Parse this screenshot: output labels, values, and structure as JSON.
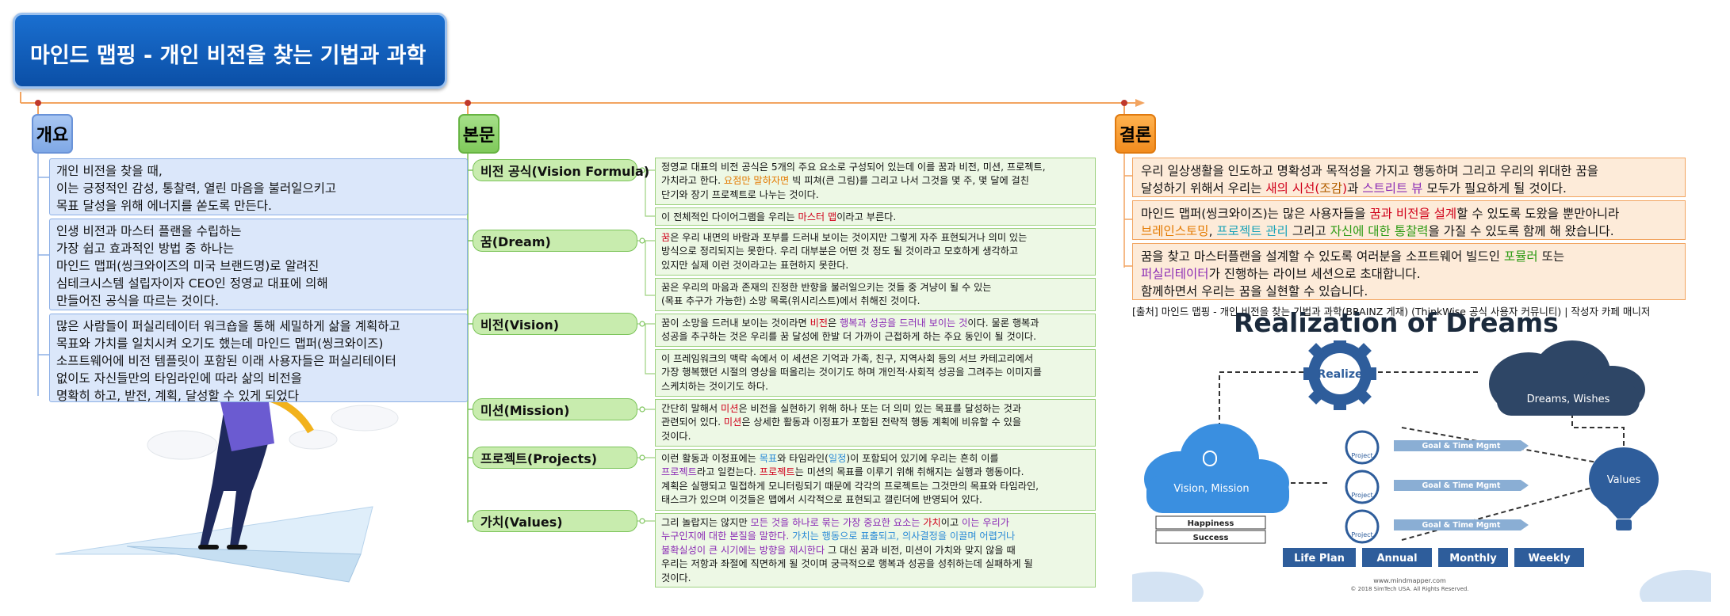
{
  "title": "마인드 맵핑 - 개인 비전을 찾는 기법과 과학",
  "sections": {
    "overview": "개요",
    "main": "본문",
    "conclusion": "결론"
  },
  "overview": {
    "box1": [
      "개인 비전을 찾을 때,",
      "이는 긍정적인 감성, 통찰력, 열린 마음을 불러일으키고",
      "목표 달성을 위해 에너지를 쏟도록 만든다."
    ],
    "box2": [
      "인생 비전과 마스터 플랜을 수립하는",
      "가장 쉽고 효과적인 방법 중 하나는",
      "마인드 맵퍼(씽크와이즈의 미국 브랜드명)로 알려진",
      "심테크시스템 설립자이자 CEO인 정영교 대표에 의해",
      "만들어진 공식을 따르는 것이다."
    ],
    "box3": [
      "많은 사람들이 퍼실리테이터 워크숍을 통해 세밀하게 삶을 계획하고",
      "목표와 가치를 일치시켜 오기도 했는데 마인드 맵퍼(씽크와이즈)",
      "소프트웨어에 비전 템플릿이 포함된 이래 사용자들은 퍼실리테이터",
      "없이도 자신들만의 타임라인에 따라 삶의 비전을",
      "명확히 하고, 받전, 계획, 달성할 수 있게 되었다"
    ]
  },
  "topics": [
    "비전 공식(Vision Formula)",
    "꿈(Dream)",
    "비전(Vision)",
    "미션(Mission)",
    "프로젝트(Projects)",
    "가치(Values)"
  ],
  "desc": {
    "formula_1": "정영교 대표의 비전 공식은 5개의 주요 요소로 구성되어 있는데 이를 꿈과 비전, 미션, 프로젝트,",
    "formula_2_a": "가치라고 한다. ",
    "formula_2_b": "요점만 말하자면",
    "formula_2_c": " 빅 피쳐(큰 그림)를 그리고 나서 그것을 몇 주, 몇 달에 걸친",
    "formula_3": "단기와 장기 프로젝트로 나누는 것이다.",
    "formula2_a": "이 전체적인 다이어그램을 우리는 ",
    "formula2_b": "마스터 맵",
    "formula2_c": "이라고 부른다.",
    "dream_1_a": "꿈",
    "dream_1_b": "은 우리 내면의 바람과 포부를 드러내 보이는 것이지만 그렇게 자주 표현되거나 의미 있는",
    "dream_2": "방식으로 정리되지는 못한다. 우리 대부분은 어떤 것 정도 될 것이라고 모호하게 생각하고",
    "dream_3": "있지만 실제 이런 것이라고는 표현하지 못한다.",
    "dream2_1": "꿈은 우리의 마음과 존재의 진정한 반향을 불러일으키는 것들 중 겨냥이 될 수 있는",
    "dream2_2": "(목표 추구가 가능한) 소망 목록(위시리스트)에서 취해진 것이다.",
    "vision_1_a": "꿈이 소망을 드러내 보이는 것이라면 ",
    "vision_1_b": "비전",
    "vision_1_c": "은 ",
    "vision_1_d": "행복과 성공을 드러내 보이는 것",
    "vision_1_e": "이다. 물론 행복과",
    "vision_2": "성공을 추구하는 것은 우리를 꿈 달성에 한발 더 가까이 근접하게 하는 주요 동인이 될 것이다.",
    "vision2_1": "이 프레임워크의 맥락 속에서 이 세션은 기억과 가족, 친구, 지역사회 등의 서브 카테고리에서",
    "vision2_2": "가장 행복했던 시절의 영상을 떠올리는 것이기도 하며 개인적·사회적 성공을 그려주는 이미지를",
    "vision2_3": "스케치하는 것이기도 하다.",
    "mission_1_a": "간단히 말해서 ",
    "mission_1_b": "미션",
    "mission_1_c": "은 비전을 실현하기 위해 하나 또는 더 의미 있는 목표를 달성하는 것과",
    "mission_2_a": "관련되어 있다. ",
    "mission_2_b": "미션",
    "mission_2_c": "은 상세한 활동과 이정표가 포함된 전략적 행동 계획에 비유할 수 있을",
    "mission_3": "것이다.",
    "proj_1_a": "이런 활동과 이정표에는 ",
    "proj_1_b": "목표",
    "proj_1_c": "와 타임라인(",
    "proj_1_d": "일정",
    "proj_1_e": ")이 포함되어 있기에 우리는 흔히 이를",
    "proj_2_a": "프로젝트",
    "proj_2_b": "라고 일컫는다. ",
    "proj_2_c": "프로젝트",
    "proj_2_d": "는 미션의 목표를 이루기 위해 취해지는 실행과 행동이다.",
    "proj_3": "계획은 실행되고 밀접하게 모니터링되기 때문에 각각의 프로젝트는 그것만의 목표와 타임라인,",
    "proj_4": "태스크가 있으며 이것들은 맵에서 시각적으로 표현되고 갤린더에 반영되어 있다.",
    "val_1_a": "그리 놀랍지는 않지만 ",
    "val_1_b": "모든 것을 하나로 묶는 가장 중요한 요소는 ",
    "val_1_c": "가치",
    "val_1_d": "이고 ",
    "val_1_e": "이는 우리가",
    "val_2_a": "누구인지에 대한 본질을 말한다. ",
    "val_2_b": "가치는 행동으로 표출되고, 의사결정을 이끌며 어렵거나",
    "val_3_a": "불확실성이 큰 시기에는 방향을 제시한다",
    "val_3_b": " 그 대신 꿈과 비전, 미션이 가치와 맞지 않을 때",
    "val_4": "우리는 저항과 좌절에 직면하게 될 것이며 궁극적으로 행복과 성공을 성취하는데 실패하게 될",
    "val_5": "것이다."
  },
  "conclusion": {
    "c1_1": "우리 일상생활을 인도하고 명확성과 목적성을 가지고 행동하며 그리고 우리의 위대한 꿈을",
    "c1_2_a": "달성하기 위해서 우리는 ",
    "c1_2_b": "새의 시선(",
    "c1_2_c": "조감",
    "c1_2_d": ")",
    "c1_2_e": "과 ",
    "c1_2_f": "스트리트 뷰",
    "c1_2_g": " 모두가 필요하게 될 것이다.",
    "c2_1_a": "마인드 맵퍼(씽크와이즈)는 많은 사용자들을 ",
    "c2_1_b": "꿈과 비전을 설계",
    "c2_1_c": "할 수 있도록 도왔을 뿐만아니라",
    "c2_2_a": "브레인스토밍",
    "c2_2_b": ", ",
    "c2_2_c": "프로젝트 관리",
    "c2_2_d": " 그리고 ",
    "c2_2_e": "자신에 대한 통찰력",
    "c2_2_f": "을 가질 수 있도록 함께 해 왔습니다.",
    "c3_1_a": "꿈을 찾고 마스터플랜을 설계할 수 있도록 여러분을 소프트웨어 빌드인 ",
    "c3_1_b": "포뮬러",
    "c3_1_c": " 또는",
    "c3_2_a": "퍼실리테이터",
    "c3_2_b": "가 진행하는 라이브 세션으로 초대합니다.",
    "c3_3": "함께하면서 우리는 꿈을 실현할 수 있습니다.",
    "source": "[출처] 마인드 맵핑 - 개인 비전을 찾는 기법과 과학(BRAINZ 게재) (ThinkWise 공식 사용자 커뮤니티) | 작성자 카페 매니저"
  },
  "figure": {
    "title": "Realization of Dreams",
    "realize": "Realize",
    "dreams": "Dreams, Wishes",
    "vision": "Vision, Mission",
    "values": "Values",
    "project": "Project",
    "goal": "Goal & Time Mgmt",
    "happiness": "Happiness",
    "success": "Success",
    "plans": [
      "Life Plan",
      "Annual",
      "Monthly",
      "Weekly"
    ],
    "url": "www.mindmapper.com",
    "copy": "© 2018 SimTech USA. All Rights Reserved."
  },
  "colors": {
    "title_bg": "#0b4fa6",
    "overview_fill": "#dbe7fa",
    "main_fill": "#edf8e5",
    "conclusion_fill": "#fdebd9",
    "timeline": "#f2a460",
    "figure_blue": "#3a7fcf",
    "figure_navy": "#2e4666"
  }
}
